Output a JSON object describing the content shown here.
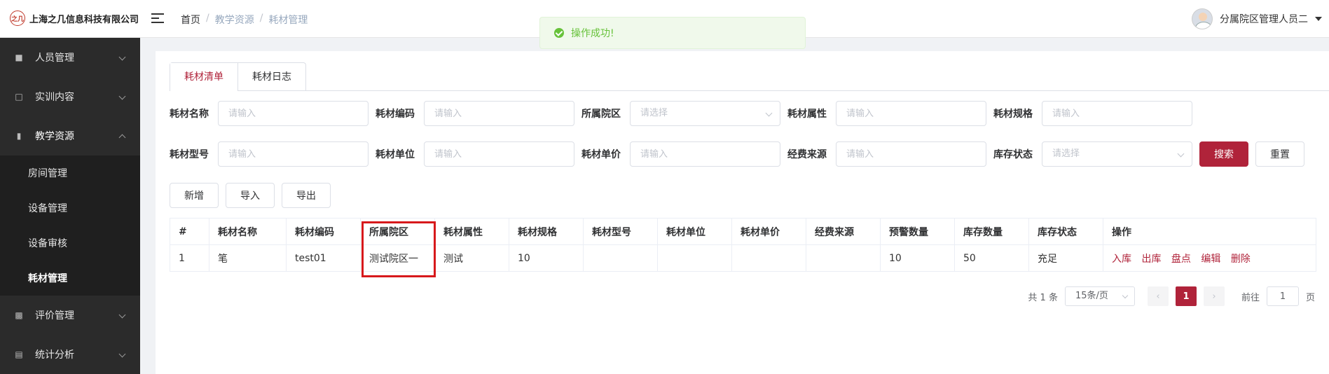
{
  "header": {
    "logo_mark": "之几",
    "company": "上海之几信息科技有限公司",
    "breadcrumb": [
      "首页",
      "教学资源",
      "耗材管理"
    ],
    "user_name": "分属院区管理人员二"
  },
  "toast": {
    "message": "操作成功!"
  },
  "sidebar": {
    "items": [
      {
        "label": "人员管理",
        "icon": "user-icon"
      },
      {
        "label": "实训内容",
        "icon": "book-icon"
      },
      {
        "label": "教学资源",
        "icon": "resource-icon"
      },
      {
        "label": "评价管理",
        "icon": "rating-icon"
      },
      {
        "label": "统计分析",
        "icon": "chart-icon"
      }
    ],
    "submenu": [
      "房间管理",
      "设备管理",
      "设备审核",
      "耗材管理"
    ]
  },
  "tabs": [
    "耗材清单",
    "耗材日志"
  ],
  "filters": {
    "row1": [
      {
        "label": "耗材名称",
        "placeholder": "请输入"
      },
      {
        "label": "耗材编码",
        "placeholder": "请输入"
      },
      {
        "label": "所属院区",
        "placeholder": "请选择"
      },
      {
        "label": "耗材属性",
        "placeholder": "请输入"
      },
      {
        "label": "耗材规格",
        "placeholder": "请输入"
      }
    ],
    "row2": [
      {
        "label": "耗材型号",
        "placeholder": "请输入"
      },
      {
        "label": "耗材单位",
        "placeholder": "请输入"
      },
      {
        "label": "耗材单价",
        "placeholder": "请输入"
      },
      {
        "label": "经费来源",
        "placeholder": "请输入"
      },
      {
        "label": "库存状态",
        "placeholder": "请选择"
      }
    ],
    "search_label": "搜索",
    "reset_label": "重置"
  },
  "toolbar": {
    "add": "新增",
    "import": "导入",
    "export": "导出"
  },
  "table": {
    "headers": [
      "#",
      "耗材名称",
      "耗材编码",
      "所属院区",
      "耗材属性",
      "耗材规格",
      "耗材型号",
      "耗材单位",
      "耗材单价",
      "经费来源",
      "预警数量",
      "库存数量",
      "库存状态",
      "操作"
    ],
    "rows": [
      [
        "1",
        "笔",
        "test01",
        "测试院区一",
        "测试",
        "10",
        "",
        "",
        "",
        "",
        "10",
        "50",
        "充足"
      ]
    ],
    "actions": [
      "入库",
      "出库",
      "盘点",
      "编辑",
      "删除"
    ]
  },
  "pagination": {
    "total": "共 1 条",
    "page_size": "15条/页",
    "current_page": "1",
    "goto_prefix": "前往",
    "goto_value": "1",
    "goto_suffix": "页"
  },
  "colors": {
    "primary": "#b0233a",
    "sidebar_bg": "#2b2b2b",
    "success": "#67c23a"
  }
}
